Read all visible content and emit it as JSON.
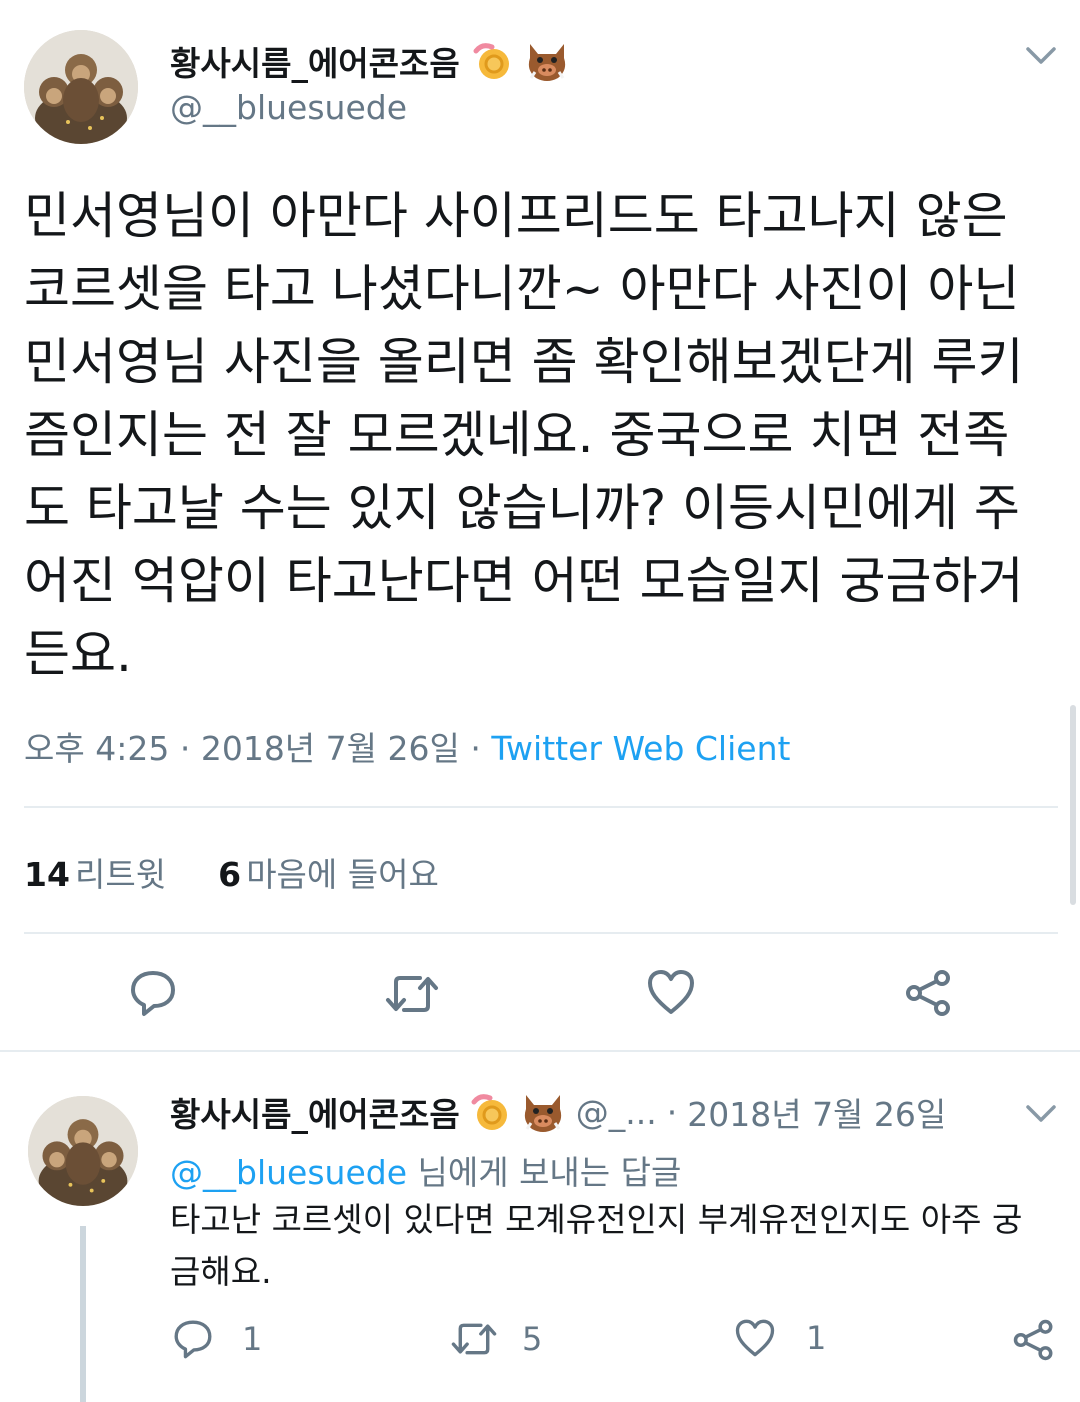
{
  "main_tweet": {
    "display_name": "황사시름_에어콘조음",
    "handle": "@__bluesuede",
    "text": "민서영님이 아만다 사이프리드도 타고나지 않은 코르셋을 타고 나셨다니깐~ 아만다 사진이 아닌 민서영님 사진을 올리면 좀 확인해보겠단게 루키즘인지는 전 잘 모르겠네요. 중국으로 치면 전족도 타고날 수는 있지 않습니까? 이등시민에게 주어진 억압이 타고난다면 어떤 모습일지 궁금하거든요.",
    "time": "오후 4:25",
    "dot1": "·",
    "date": "2018년 7월 26일",
    "dot2": "·",
    "source": "Twitter Web Client",
    "retweets_count": "14",
    "retweets_label": "리트윗",
    "likes_count": "6",
    "likes_label": "마음에 들어요"
  },
  "reply_tweet": {
    "display_name": "황사시름_에어콘조음",
    "handle_truncated": "@_...",
    "dot": "·",
    "date": "2018년 7월 26일",
    "reply_to_handle": "@__bluesuede",
    "reply_to_suffix": "님에게 보내는 답글",
    "text": "타고난 코르셋이 있다면 모계유전인지 부계유전인지도 아주 궁금해요.",
    "reply_count": "1",
    "retweet_count": "5",
    "like_count": "1"
  },
  "icons": {
    "chevron": "chevron-down-icon",
    "emoji_shell": "nautilus-emoji-icon",
    "emoji_boar": "boar-emoji-icon",
    "reply": "reply-icon",
    "retweet": "retweet-icon",
    "like": "heart-icon",
    "share": "share-icon"
  },
  "colors": {
    "link": "#1da1f2",
    "secondary_text": "#657786",
    "icon": "#657786",
    "divider": "#e6ecf0"
  }
}
